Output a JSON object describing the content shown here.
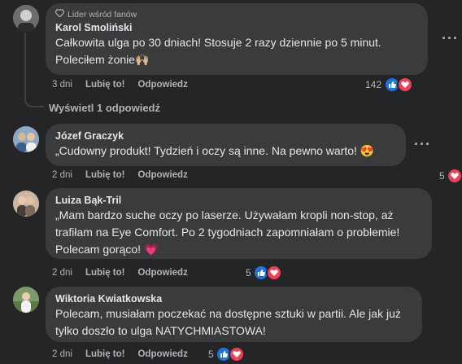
{
  "comments": [
    {
      "badge": "Lider wśród fanów",
      "author": "Karol Smoliński",
      "lines": [
        "Całkowita ulga po 30 dniach! Stosuje 2 razy dziennie po 5 minut.",
        "Poleciłem żonie🙌🏼"
      ],
      "time": "3 dni",
      "like": "Lubię to!",
      "reply": "Odpowiedz",
      "reaction_count": "142"
    },
    {
      "author": "Józef Graczyk",
      "lines": [
        "„Cudowny produkt! Tydzień i oczy są inne. Na pewno warto! 😍"
      ],
      "time": "2 dni",
      "like": "Lubię to!",
      "reply": "Odpowiedz",
      "reaction_count": "5"
    },
    {
      "author": "Luiza Bąk-Tril",
      "lines": [
        "„Mam bardzo suche oczy po laserze. Używałam kropli non-stop, aż",
        "trafiłam na Eye Comfort. Po 2 tygodniach zapomniałam o problemie!",
        "Polecam gorąco! 💗"
      ],
      "time": "2 dni",
      "like": "Lubię to!",
      "reply": "Odpowiedz",
      "reaction_count": "5"
    },
    {
      "author": "Wiktoria Kwiatkowska",
      "lines": [
        "Polecam, musiałam poczekać na dostępne sztuki w partii. Ale jak już",
        "tylko doszło to ulga NATYCHMIASTOWA!"
      ],
      "time": "2 dni",
      "like": "Lubię to!",
      "reply": "Odpowiedz",
      "reaction_count": "5"
    }
  ],
  "view_replies": "Wyświetl 1 odpowiedź",
  "icons": {
    "badge": "diamond-icon",
    "more": "more-options-icon",
    "like": "like-reaction-icon",
    "love": "love-reaction-icon"
  },
  "colors": {
    "background": "#242526",
    "bubble": "#3a3b3c",
    "like": "#1b74e4",
    "love": "#f33e58"
  }
}
